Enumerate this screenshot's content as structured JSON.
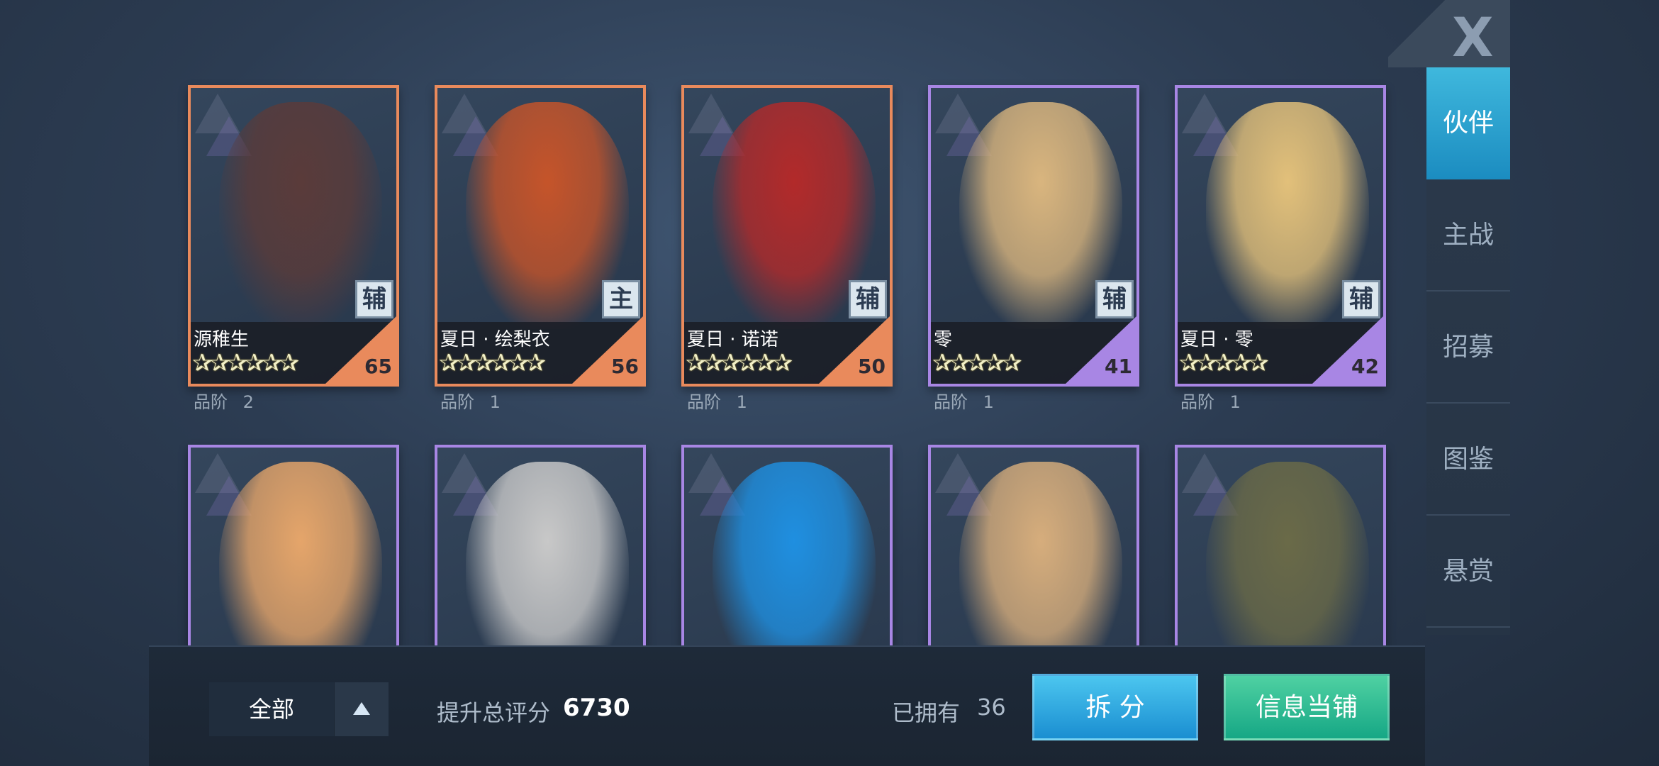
{
  "close": {
    "label": "X"
  },
  "side_nav": [
    {
      "label": "伙伴",
      "active": true
    },
    {
      "label": "主战",
      "active": false
    },
    {
      "label": "招募",
      "active": false
    },
    {
      "label": "图鉴",
      "active": false
    },
    {
      "label": "悬赏",
      "active": false
    }
  ],
  "cards": [
    {
      "name": "源稚生",
      "role": "辅",
      "stars": "✰✰✰✰✰✰",
      "level": "65",
      "grade_label": "品阶",
      "grade": "2",
      "rarity": "orange",
      "portrait": "#5a3b3a"
    },
    {
      "name": "夏日 · 绘梨衣",
      "role": "主",
      "stars": "✰✰✰✰✰✰",
      "level": "56",
      "grade_label": "品阶",
      "grade": "1",
      "rarity": "orange",
      "portrait": "#c5542a"
    },
    {
      "name": "夏日 · 诺诺",
      "role": "辅",
      "stars": "✰✰✰✰✰✰",
      "level": "50",
      "grade_label": "品阶",
      "grade": "1",
      "rarity": "orange",
      "portrait": "#b22a2a"
    },
    {
      "name": "零",
      "role": "辅",
      "stars": "✰✰✰✰✰",
      "level": "41",
      "grade_label": "品阶",
      "grade": "1",
      "rarity": "purple",
      "portrait": "#d9b57e"
    },
    {
      "name": "夏日 · 零",
      "role": "辅",
      "stars": "✰✰✰✰✰",
      "level": "42",
      "grade_label": "品阶",
      "grade": "1",
      "rarity": "purple",
      "portrait": "#e2c07a"
    },
    {
      "name": "",
      "role": "",
      "stars": "",
      "level": "",
      "grade_label": "",
      "grade": "",
      "rarity": "purple",
      "portrait": "#e5a56a"
    },
    {
      "name": "",
      "role": "",
      "stars": "",
      "level": "",
      "grade_label": "",
      "grade": "",
      "rarity": "purple",
      "portrait": "#c8c8c8"
    },
    {
      "name": "",
      "role": "",
      "stars": "",
      "level": "",
      "grade_label": "",
      "grade": "",
      "rarity": "purple",
      "portrait": "#1f8fe0"
    },
    {
      "name": "",
      "role": "",
      "stars": "",
      "level": "",
      "grade_label": "",
      "grade": "",
      "rarity": "purple",
      "portrait": "#d6ad7c"
    },
    {
      "name": "",
      "role": "",
      "stars": "",
      "level": "",
      "grade_label": "",
      "grade": "",
      "rarity": "purple",
      "portrait": "#6a6a48"
    }
  ],
  "bottom": {
    "filter_label": "全部",
    "score_label": "提升总评分",
    "score_value": "6730",
    "owned_label": "已拥有",
    "owned_value": "36",
    "dismantle_label": "拆 分",
    "info_label": "信息当铺"
  }
}
